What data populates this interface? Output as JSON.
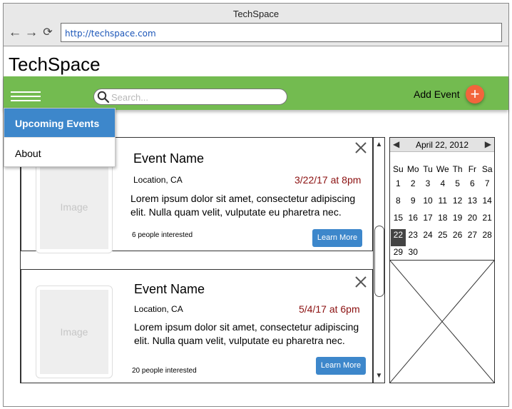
{
  "browser": {
    "title": "TechSpace",
    "url": "http://techspace.com",
    "back_glyph": "←",
    "forward_glyph": "→",
    "reload_glyph": "⟳"
  },
  "site": {
    "title": "TechSpace"
  },
  "navbar": {
    "search_placeholder": "Search...",
    "add_event_label": "Add Event",
    "add_icon_glyph": "+",
    "accent_color": "#73bb50"
  },
  "menu": {
    "items": [
      {
        "label": "Upcoming Events",
        "active": true
      },
      {
        "label": "About",
        "active": false
      }
    ]
  },
  "events": [
    {
      "name": "Event Name",
      "location": "Location, CA",
      "date": "3/22/17 at 8pm",
      "description": "Lorem ipsum dolor sit amet, consectetur adipiscing elit. Nulla quam velit, vulputate eu pharetra nec.",
      "interested": "6 people interested",
      "image_label": "Image",
      "button_label": "Learn More"
    },
    {
      "name": "Event Name",
      "location": "Location, CA",
      "date": "5/4/17 at 6pm",
      "description": "Lorem ipsum dolor sit amet, consectetur adipiscing elit. Nulla quam velit, vulputate eu pharetra nec.",
      "interested": "20 people interested",
      "image_label": "Image",
      "button_label": "Learn More"
    }
  ],
  "calendar": {
    "title": "April 22, 2012",
    "prev_glyph": "◀",
    "next_glyph": "▶",
    "weekdays": [
      "Su",
      "Mo",
      "Tu",
      "We",
      "Th",
      "Fr",
      "Sa"
    ],
    "weeks": [
      [
        "1",
        "2",
        "3",
        "4",
        "5",
        "6",
        "7"
      ],
      [
        "8",
        "9",
        "10",
        "11",
        "12",
        "13",
        "14"
      ],
      [
        "15",
        "16",
        "17",
        "18",
        "19",
        "20",
        "21"
      ],
      [
        "22",
        "23",
        "24",
        "25",
        "26",
        "27",
        "28"
      ],
      [
        "29",
        "30",
        "",
        "",
        "",
        "",
        ""
      ]
    ],
    "selected_day": "22"
  },
  "scrollbar": {
    "up_glyph": "▲",
    "down_glyph": "▼"
  }
}
